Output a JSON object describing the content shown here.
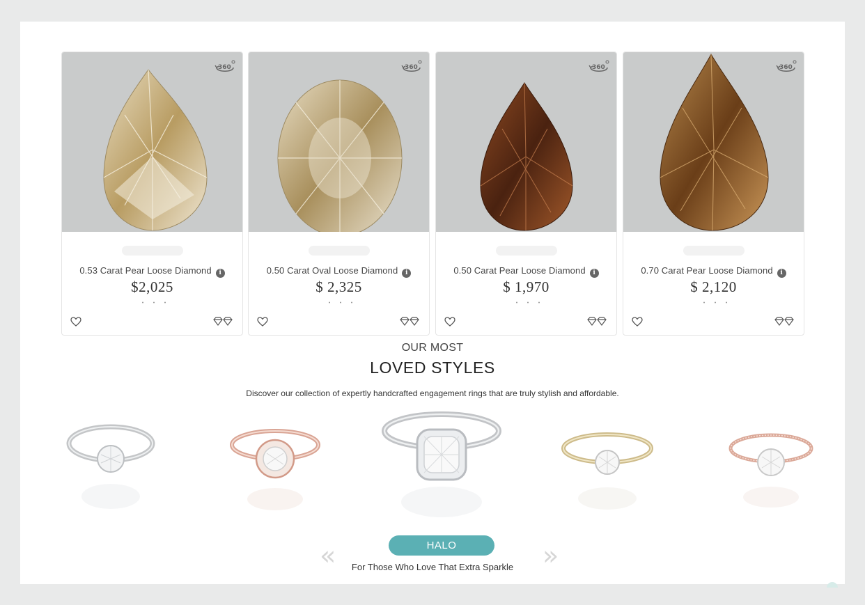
{
  "diamonds": [
    {
      "title": "0.53 Carat Pear Loose Diamond",
      "price": "$2,025",
      "info_icon": "i",
      "spin_label": "360",
      "shape": "pear",
      "tone": "champagne"
    },
    {
      "title": "0.50 Carat Oval Loose Diamond",
      "price": "$ 2,325",
      "info_icon": "i",
      "spin_label": "360",
      "shape": "oval",
      "tone": "champagne"
    },
    {
      "title": "0.50 Carat Pear Loose Diamond",
      "price": "$ 1,970",
      "info_icon": "i",
      "spin_label": "360",
      "shape": "pear",
      "tone": "cognac"
    },
    {
      "title": "0.70 Carat Pear Loose Diamond",
      "price": "$ 2,120",
      "info_icon": "i",
      "spin_label": "360",
      "shape": "pear",
      "tone": "brown"
    }
  ],
  "section": {
    "eyebrow": "OUR MOST",
    "headline": "LOVED STYLES",
    "subline": "Discover our collection of expertly handcrafted engagement rings that are truly stylish and affordable."
  },
  "carousel": {
    "prev_label": "«",
    "next_label": "»",
    "active_style": "HALO",
    "tagline": "For Those Who Love That Extra Sparkle",
    "rings": [
      {
        "metal": "white-gold",
        "name": "twist-ring-icon"
      },
      {
        "metal": "rose-gold",
        "name": "floral-halo-ring-icon"
      },
      {
        "metal": "white-gold",
        "name": "cushion-halo-ring-icon"
      },
      {
        "metal": "yellow-gold",
        "name": "solitaire-ring-icon"
      },
      {
        "metal": "rose-gold",
        "name": "pave-ring-icon"
      }
    ]
  },
  "colors": {
    "accent": "#5bb0b4",
    "photo_bg": "#c9cbcb",
    "champagne": "#c9b48a",
    "cognac": "#6b3a1c",
    "brown": "#8a5a2a"
  }
}
